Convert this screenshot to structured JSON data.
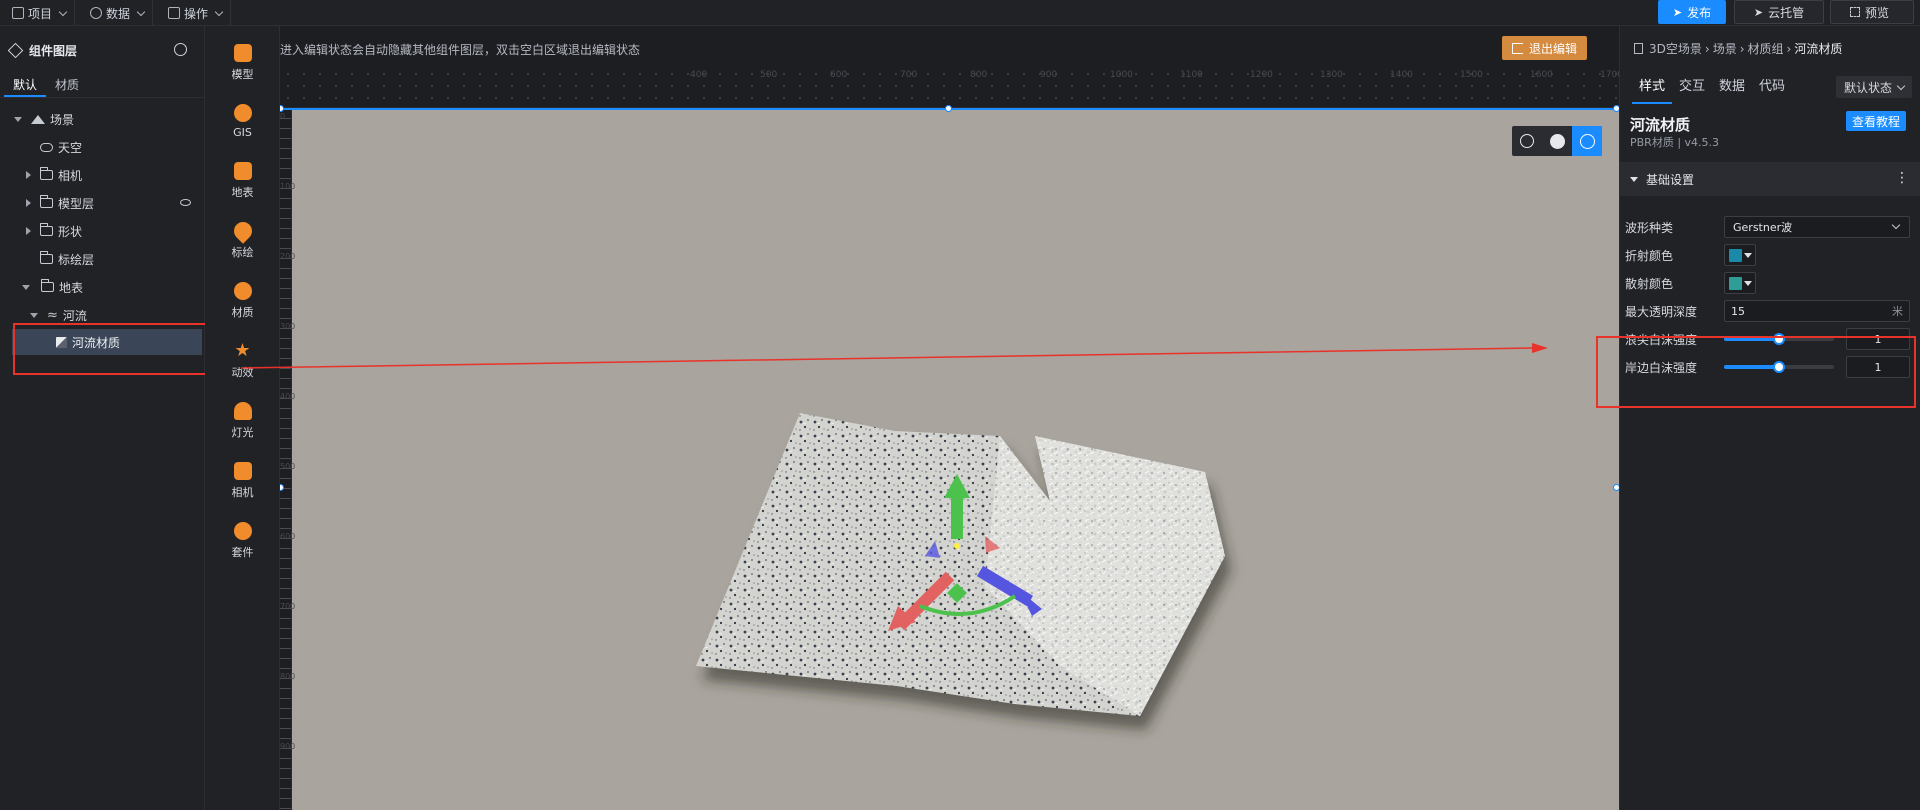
{
  "topbar": {
    "menus": [
      {
        "label": "项目",
        "icon": "file-icon"
      },
      {
        "label": "数据",
        "icon": "database-icon"
      },
      {
        "label": "操作",
        "icon": "grid-icon"
      }
    ],
    "publish_label": "发布",
    "cloud_label": "云托管",
    "preview_label": "预览"
  },
  "layers": {
    "title": "组件图层",
    "tabs": [
      "默认",
      "材质"
    ],
    "items": [
      {
        "label": "场景"
      },
      {
        "label": "天空"
      },
      {
        "label": "相机"
      },
      {
        "label": "模型层"
      },
      {
        "label": "形状"
      },
      {
        "label": "标绘层"
      },
      {
        "label": "地表"
      },
      {
        "label": "河流"
      },
      {
        "label": "河流材质"
      }
    ]
  },
  "tools": [
    {
      "label": "模型"
    },
    {
      "label": "GIS"
    },
    {
      "label": "地表"
    },
    {
      "label": "标绘"
    },
    {
      "label": "材质"
    },
    {
      "label": "动效"
    },
    {
      "label": "灯光"
    },
    {
      "label": "相机"
    },
    {
      "label": "套件"
    }
  ],
  "canvas": {
    "hint": "进入编辑状态会自动隐藏其他组件图层，双击空白区域退出编辑状态",
    "exit_label": "退出编辑",
    "ruler_h": [
      "400",
      "500",
      "600",
      "700",
      "800",
      "900",
      "1000",
      "1100",
      "1200",
      "1300",
      "1400",
      "1500",
      "1600",
      "1700"
    ],
    "ruler_v": [
      "0",
      "100",
      "200",
      "300",
      "400",
      "500",
      "600",
      "700",
      "800",
      "900",
      "1000"
    ],
    "background": "#a9a49d"
  },
  "props": {
    "breadcrumb": [
      "3D空场景",
      "场景",
      "材质组",
      "河流材质"
    ],
    "tabs": [
      "样式",
      "交互",
      "数据",
      "代码"
    ],
    "state_label": "默认状态",
    "title": "河流材质",
    "subtitle": "PBR材质 | v4.5.3",
    "tutorial_label": "查看教程",
    "section_label": "基础设置",
    "wave_type_label": "波形种类",
    "wave_type_value": "Gerstner波",
    "refract_label": "折射颜色",
    "refract_color": "#1a8aa8",
    "scatter_label": "散射颜色",
    "scatter_color": "#2f9c96",
    "max_depth_label": "最大透明深度",
    "max_depth_value": "15",
    "max_depth_unit": "米",
    "crest_foam_label": "浪尖白沫强度",
    "crest_foam_value": "1",
    "crest_foam_fraction": 0.5,
    "shore_foam_label": "岸边白沫强度",
    "shore_foam_value": "1",
    "shore_foam_fraction": 0.5
  },
  "colors": {
    "accent": "#1a8cff",
    "annotation": "#e8332a",
    "exit_button": "#d48a3f"
  }
}
